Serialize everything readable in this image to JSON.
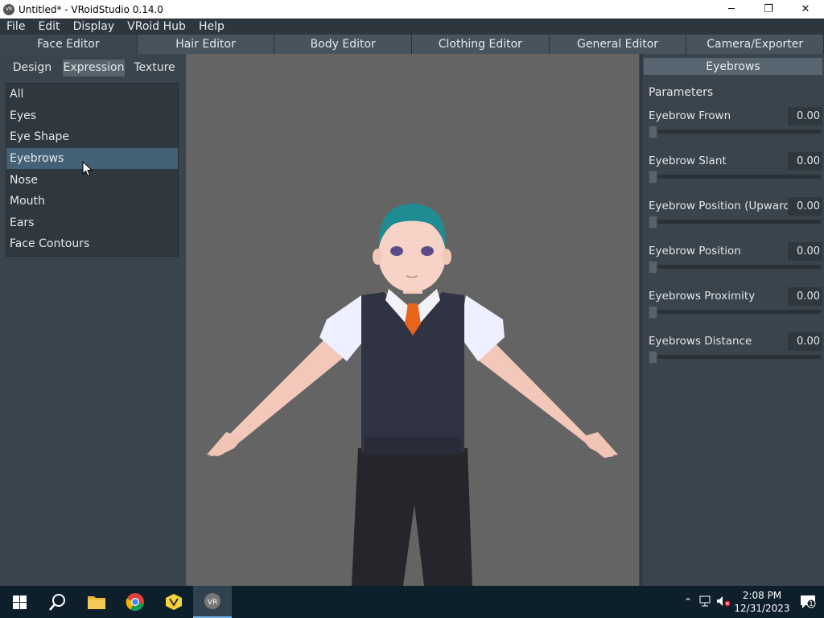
{
  "window": {
    "title": "Untitled* - VRoidStudio 0.14.0",
    "app_icon_text": "VR",
    "minimize": "─",
    "restore": "❐",
    "close": "✕"
  },
  "menu": [
    "File",
    "Edit",
    "Display",
    "VRoid Hub",
    "Help"
  ],
  "editor_tabs": [
    "Face Editor",
    "Hair Editor",
    "Body Editor",
    "Clothing Editor",
    "General Editor",
    "Camera/Exporter"
  ],
  "sub_tabs": [
    "Design",
    "Expression",
    "Texture"
  ],
  "categories": [
    "All",
    "Eyes",
    "Eye Shape",
    "Eyebrows",
    "Nose",
    "Mouth",
    "Ears",
    "Face Contours"
  ],
  "selected_category": "Eyebrows",
  "right_panel": {
    "header": "Eyebrows",
    "params_label": "Parameters",
    "params": [
      {
        "label": "Eyebrow Frown",
        "value": "0.00"
      },
      {
        "label": "Eyebrow Slant",
        "value": "0.00"
      },
      {
        "label": "Eyebrow Position (Upward)",
        "value": "0.00"
      },
      {
        "label": "Eyebrow Position",
        "value": "0.00"
      },
      {
        "label": "Eyebrows Proximity",
        "value": "0.00"
      },
      {
        "label": "Eyebrows Distance",
        "value": "0.00"
      }
    ]
  },
  "taskbar": {
    "time": "2:08 PM",
    "date": "12/31/2023",
    "notification_count": "1"
  },
  "colors": {
    "accent": "#446176",
    "panel": "#3a444c",
    "viewport": "#646464"
  }
}
